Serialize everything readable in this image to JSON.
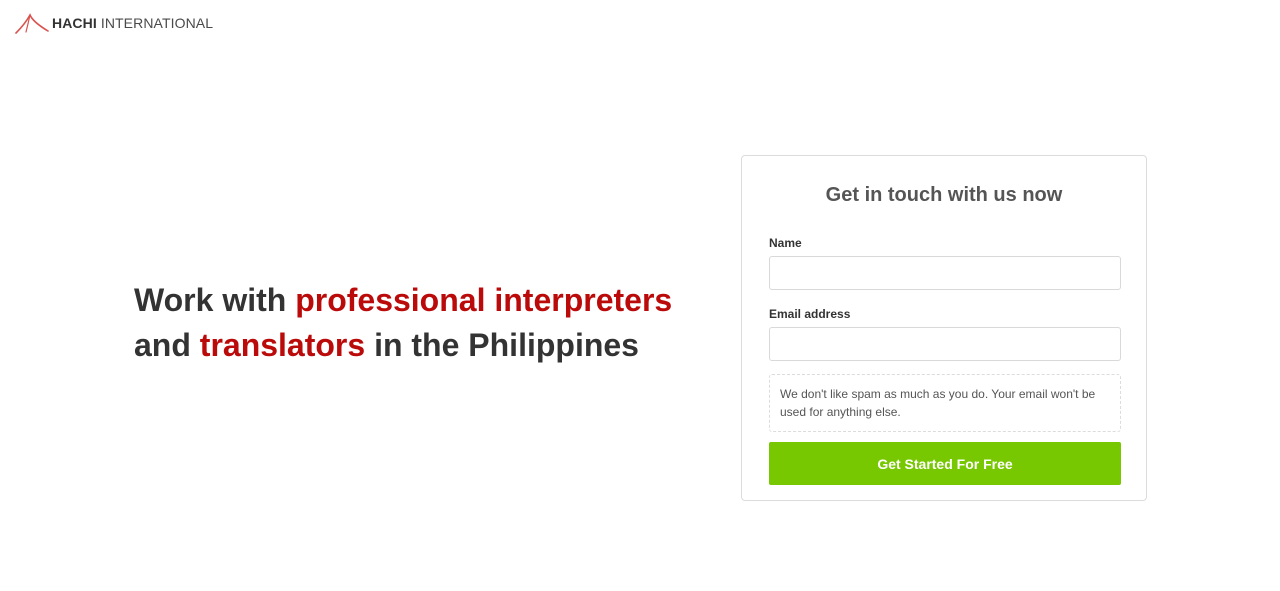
{
  "header": {
    "logo_icon": "hachi-logo-mark",
    "logo_bold": "HACHI",
    "logo_rest": " INTERNATIONAL"
  },
  "hero": {
    "line1_prefix": "Work with ",
    "line1_accent": "professional interpreters",
    "line2_prefix": "and ",
    "line2_accent": "translators",
    "line2_suffix": " in the Philippines"
  },
  "form": {
    "title": "Get in touch with us now",
    "name_label": "Name",
    "name_value": "",
    "name_placeholder": "",
    "email_label": "Email address",
    "email_value": "",
    "email_placeholder": "",
    "spam_note": "We don't like spam as much as you do. Your email won't be used for anything else.",
    "submit_label": "Get Started For Free"
  },
  "colors": {
    "accent_red": "#bb0a0a",
    "cta_green": "#77c800",
    "heading_dark": "#333333"
  }
}
